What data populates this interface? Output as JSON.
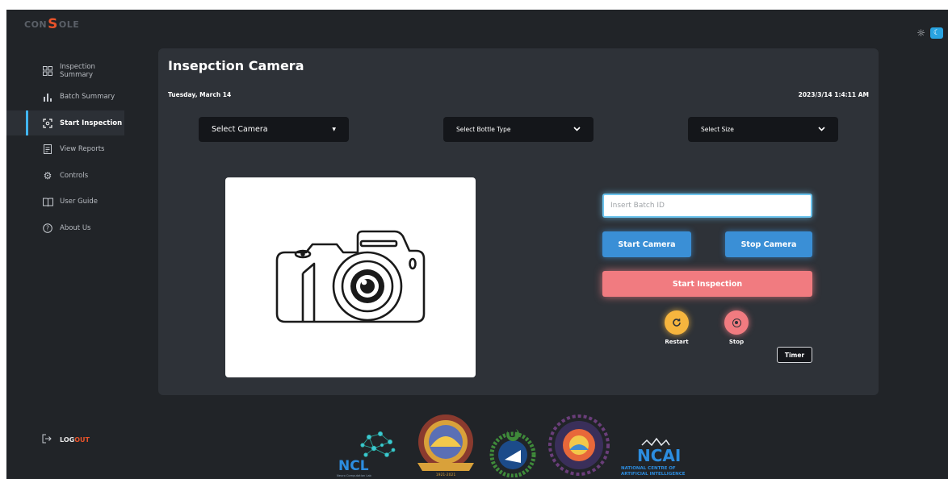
{
  "brand": {
    "prefix": "CON",
    "mark": "S",
    "suffix": "OLE"
  },
  "theme": {
    "sun_icon": "sun-icon",
    "moon_icon": "moon-icon"
  },
  "sidebar": {
    "items": [
      {
        "label": "Inspection Summary",
        "icon": "grid-icon",
        "active": false
      },
      {
        "label": "Batch Summary",
        "icon": "bar-chart-icon",
        "active": false
      },
      {
        "label": "Start Inspection",
        "icon": "scan-icon",
        "active": true
      },
      {
        "label": "View Reports",
        "icon": "report-icon",
        "active": false
      },
      {
        "label": "Controls",
        "icon": "gear-icon",
        "active": false
      },
      {
        "label": "User Guide",
        "icon": "book-icon",
        "active": false
      },
      {
        "label": "About Us",
        "icon": "question-icon",
        "active": false
      }
    ],
    "logout": {
      "log": "LOG",
      "out": "OUT"
    }
  },
  "main": {
    "title": "Insepction Camera",
    "date_left": "Tuesday, March 14",
    "date_right": "2023/3/14 1:4:11 AM",
    "selects": {
      "camera": "Select Camera",
      "bottle": "Select Bottle Type",
      "size": "Select Size"
    },
    "batch_placeholder": "Insert Batch ID",
    "buttons": {
      "start_camera": "Start Camera",
      "stop_camera": "Stop Camera",
      "start_inspection": "Start Inspection",
      "restart": "Restart",
      "stop": "Stop",
      "timer": "Timer"
    }
  },
  "footer": {
    "logos": [
      "NCL",
      "NCAI",
      "NATIONAL CENTRE OF",
      "ARTIFICIAL INTELLIGENCE",
      "Neuro Computation Lab",
      "1921-2021"
    ]
  },
  "colors": {
    "background": "#212428",
    "panel": "#2e3238",
    "accent_blue": "#3a8fd6",
    "accent_pink": "#f17b80",
    "accent_yellow": "#f6b53e",
    "brand_orange": "#e8532a"
  }
}
